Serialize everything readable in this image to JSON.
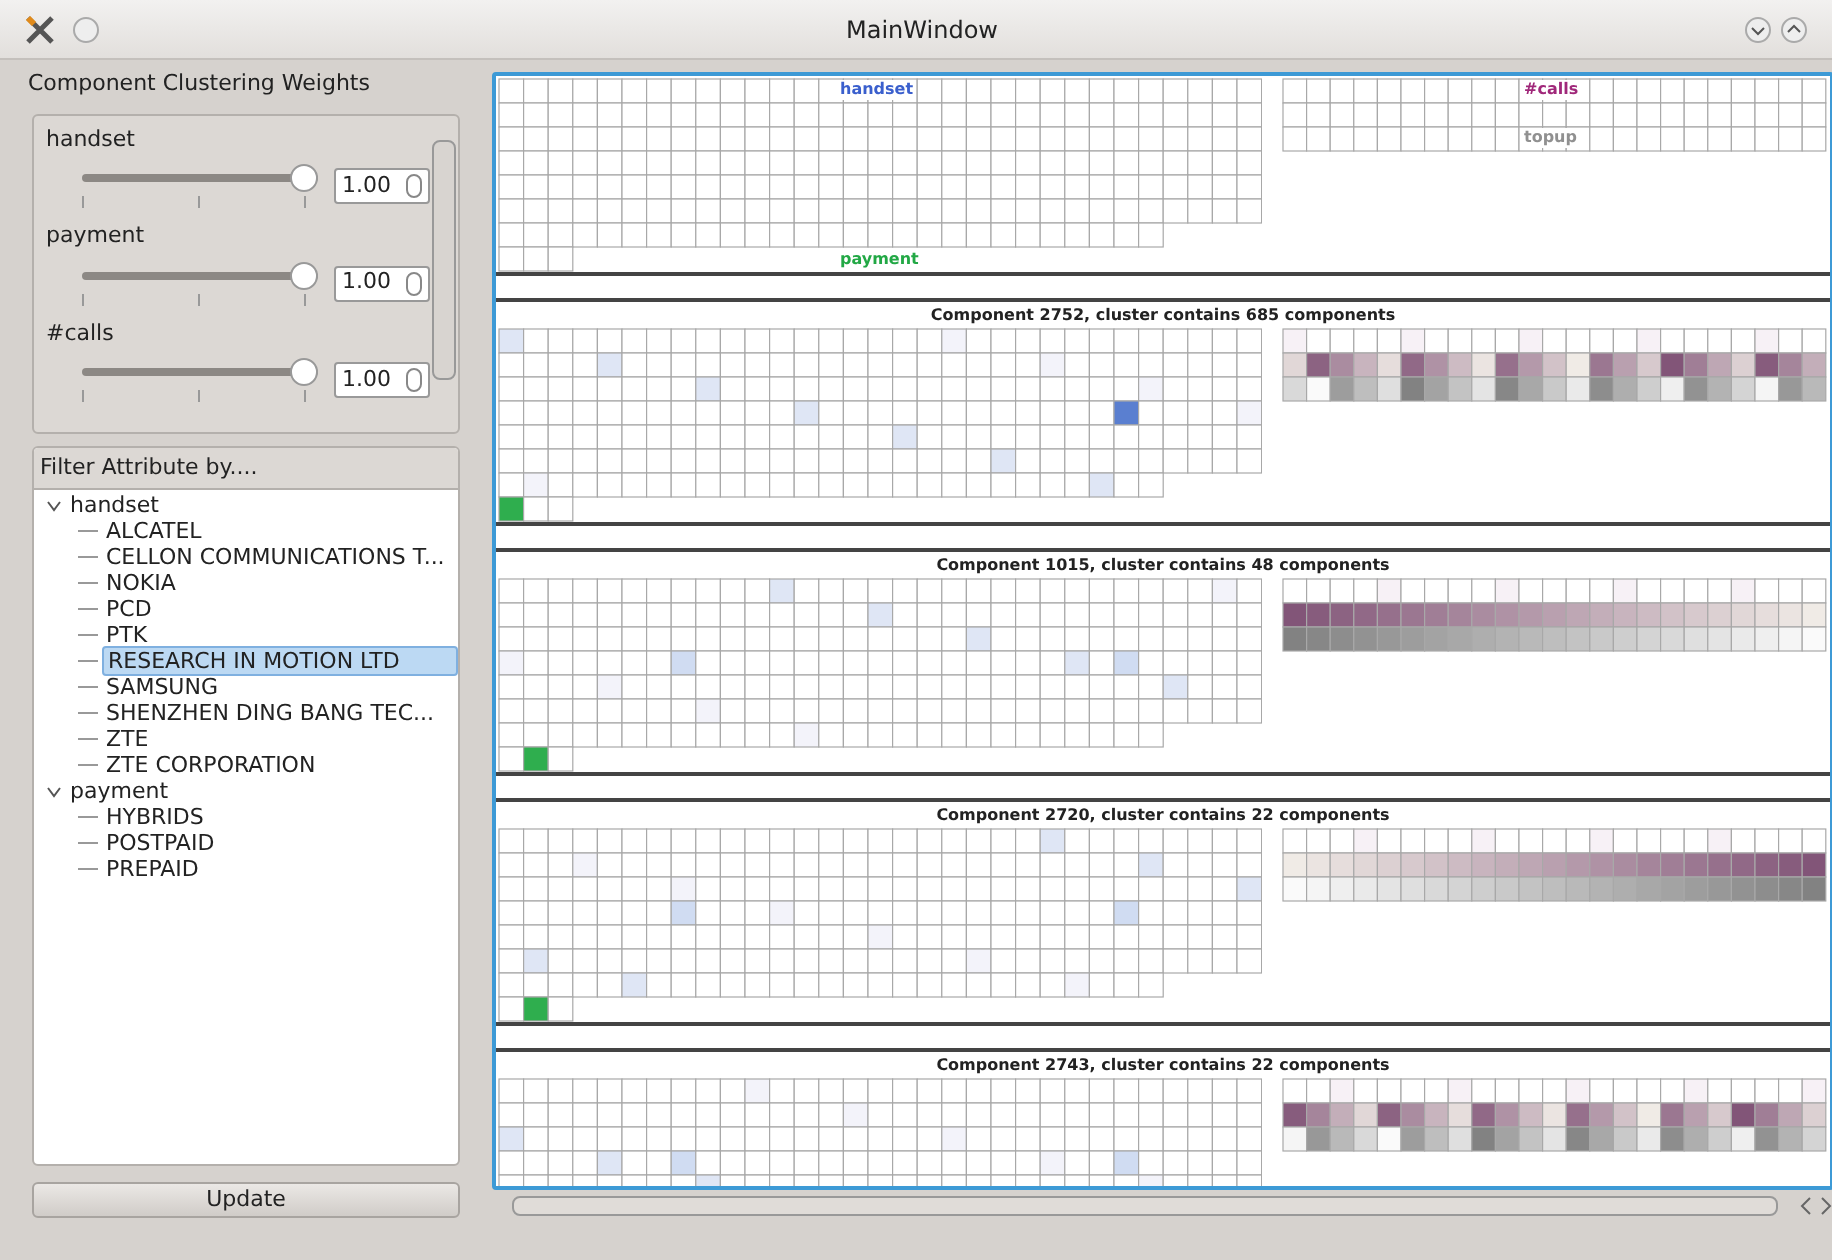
{
  "window": {
    "title": "MainWindow"
  },
  "weights_panel": {
    "title": "Component Clustering Weights",
    "weights": [
      {
        "label": "handset",
        "value": "1.00",
        "level": 1.0
      },
      {
        "label": "payment",
        "value": "1.00",
        "level": 1.0
      },
      {
        "label": "#calls",
        "value": "1.00",
        "level": 1.0
      }
    ]
  },
  "filter_panel": {
    "title": "Filter Attribute by....",
    "tree": [
      {
        "label": "handset",
        "expanded": true,
        "selected": false,
        "children": [
          {
            "label": "ALCATEL",
            "selected": false
          },
          {
            "label": "CELLON COMMUNICATIONS T...",
            "selected": false
          },
          {
            "label": "NOKIA",
            "selected": false
          },
          {
            "label": "PCD",
            "selected": false
          },
          {
            "label": "PTK",
            "selected": false
          },
          {
            "label": "RESEARCH IN MOTION LTD",
            "selected": true
          },
          {
            "label": "SAMSUNG",
            "selected": false
          },
          {
            "label": "SHENZHEN DING BANG TEC...",
            "selected": false
          },
          {
            "label": "ZTE",
            "selected": false
          },
          {
            "label": "ZTE CORPORATION",
            "selected": false
          }
        ]
      },
      {
        "label": "payment",
        "expanded": true,
        "selected": false,
        "children": [
          {
            "label": "HYBRIDS",
            "selected": false
          },
          {
            "label": "POSTPAID",
            "selected": false
          },
          {
            "label": "PREPAID",
            "selected": false
          }
        ]
      }
    ]
  },
  "update_button": "Update",
  "legend": {
    "handset": {
      "label": "handset",
      "color": "#3a5fcd"
    },
    "payment": {
      "label": "payment",
      "color": "#22a845"
    },
    "calls": {
      "label": "#calls",
      "color": "#a0287a"
    },
    "topup": {
      "label": "topup",
      "color": "#909090"
    }
  },
  "components": [
    {
      "title": "Component 2752, cluster contains 685 components"
    },
    {
      "title": "Component 1015, cluster contains 48 components"
    },
    {
      "title": "Component 2720, cluster contains 22 components"
    },
    {
      "title": "Component 2743, cluster contains 22 components"
    }
  ]
}
